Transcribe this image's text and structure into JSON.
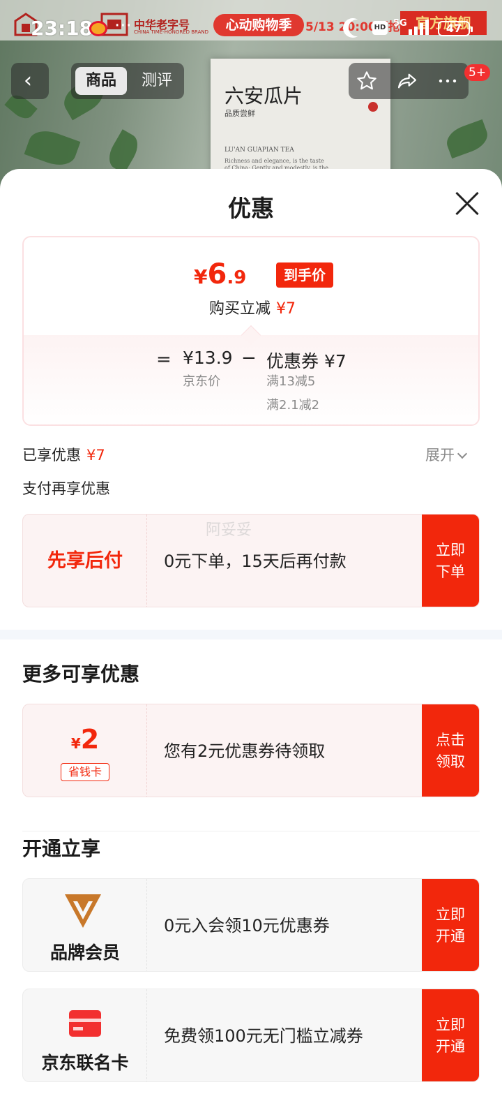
{
  "status_bar": {
    "time": "23:18",
    "more": "···",
    "network": "5G",
    "battery": "47"
  },
  "background": {
    "brand_cn": "中华老字号",
    "brand_en": "CHINA TIME-HONORED BRAND",
    "promo": "心动购物季",
    "promo_date": "5/13 20:00开抢",
    "official": "官方旗舰",
    "product_name": "六安瓜片",
    "product_sub": "品质尝鲜",
    "product_en": "LU'AN GUAPIAN TEA",
    "product_desc": "Richness and elegance, is the taste of China; Gently and modestly, is the manners of China."
  },
  "nav": {
    "tab_active": "商品",
    "tab_other": "测评",
    "badge": "5+"
  },
  "sheet": {
    "title": "优惠",
    "final_price": {
      "symbol": "¥",
      "integer": "6",
      "decimal": ".9"
    },
    "final_tag": "到手价",
    "reduction_label": "购买立减",
    "reduction_value": "¥7",
    "breakdown": {
      "equals": "=",
      "jd_price": "¥13.9",
      "jd_price_label": "京东价",
      "minus": "−",
      "coupon": "优惠券 ¥7",
      "rules": [
        "满13减5",
        "满2.1减2"
      ]
    },
    "enjoyed_label": "已享优惠",
    "enjoyed_value": "¥7",
    "expand_label": "展开",
    "pay_section_label": "支付再享优惠",
    "bnpl": {
      "title": "先享后付",
      "watermark": "阿妥妥",
      "desc": "0元下单，15天后再付款",
      "button": "立即\n下单"
    },
    "more_section": "更多可享优惠",
    "saving_card": {
      "symbol": "¥",
      "amount": "2",
      "tag": "省钱卡",
      "desc": "您有2元优惠券待领取",
      "button": "点击\n领取"
    },
    "open_section": "开通立享",
    "brand_member": {
      "label": "品牌会员",
      "desc": "0元入会领10元优惠券",
      "button": "立即\n开通"
    },
    "jd_card": {
      "label": "京东联名卡",
      "desc": "免费领100元无门槛立减券",
      "button": "立即\n开通"
    }
  },
  "colors": {
    "accent": "#f2270c",
    "member_logo": "#c8782a",
    "divider": "#f4f7fb"
  }
}
